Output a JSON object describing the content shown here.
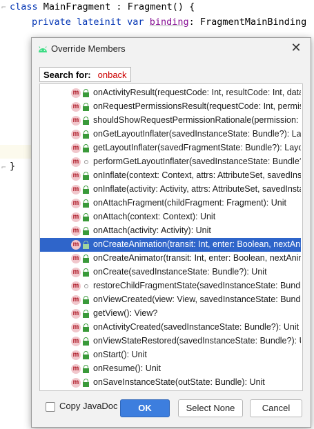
{
  "editor": {
    "line1": {
      "kw": "class",
      "text": " MainFragment : Fragment() {"
    },
    "line2": {
      "kw": "private lateinit var",
      "prop": "binding",
      "text": ": FragmentMainBinding"
    },
    "closing_brace": "}"
  },
  "dialog": {
    "title": "Override Members",
    "close_glyph": "✕",
    "search": {
      "label": "Search for:",
      "value": "onback"
    },
    "members": [
      {
        "sig": "onActivityResult(requestCode: Int, resultCode: Int, data: I",
        "vis": "lock",
        "selected": false
      },
      {
        "sig": "onRequestPermissionsResult(requestCode: Int, permissio",
        "vis": "lock",
        "selected": false
      },
      {
        "sig": "shouldShowRequestPermissionRationale(permission: Stri",
        "vis": "lock",
        "selected": false
      },
      {
        "sig": "onGetLayoutInflater(savedInstanceState: Bundle?): Layou",
        "vis": "lock",
        "selected": false
      },
      {
        "sig": "getLayoutInflater(savedFragmentState: Bundle?): LayoutI",
        "vis": "lock",
        "selected": false
      },
      {
        "sig": "performGetLayoutInflater(savedInstanceState: Bundle?): ",
        "vis": "circle",
        "selected": false
      },
      {
        "sig": "onInflate(context: Context, attrs: AttributeSet, savedInsta",
        "vis": "lock",
        "selected": false
      },
      {
        "sig": "onInflate(activity: Activity, attrs: AttributeSet, savedInsta",
        "vis": "lock",
        "selected": false
      },
      {
        "sig": "onAttachFragment(childFragment: Fragment): Unit",
        "vis": "lock",
        "selected": false
      },
      {
        "sig": "onAttach(context: Context): Unit",
        "vis": "lock",
        "selected": false
      },
      {
        "sig": "onAttach(activity: Activity): Unit",
        "vis": "lock",
        "selected": false
      },
      {
        "sig": "onCreateAnimation(transit: Int, enter: Boolean, nextAnim",
        "vis": "lock",
        "selected": true
      },
      {
        "sig": "onCreateAnimator(transit: Int, enter: Boolean, nextAnim:",
        "vis": "lock",
        "selected": false
      },
      {
        "sig": "onCreate(savedInstanceState: Bundle?): Unit",
        "vis": "lock",
        "selected": false
      },
      {
        "sig": "restoreChildFragmentState(savedInstanceState: Bundle?)",
        "vis": "circle",
        "selected": false
      },
      {
        "sig": "onViewCreated(view: View, savedInstanceState: Bundle?)",
        "vis": "lock",
        "selected": false
      },
      {
        "sig": "getView(): View?",
        "vis": "lock",
        "selected": false
      },
      {
        "sig": "onActivityCreated(savedInstanceState: Bundle?): Unit",
        "vis": "lock",
        "selected": false
      },
      {
        "sig": "onViewStateRestored(savedInstanceState: Bundle?): Unit",
        "vis": "lock",
        "selected": false
      },
      {
        "sig": "onStart(): Unit",
        "vis": "lock",
        "selected": false
      },
      {
        "sig": "onResume(): Unit",
        "vis": "lock",
        "selected": false
      },
      {
        "sig": "onSaveInstanceState(outState: Bundle): Unit",
        "vis": "lock",
        "selected": false
      }
    ],
    "member_badge": "m",
    "copy_javadoc_label": "Copy JavaDoc",
    "ok_label": "OK",
    "select_none_label": "Select None",
    "cancel_label": "Cancel"
  },
  "colors": {
    "selection": "#2f65ca",
    "ok_button": "#3d7ede",
    "search_value": "#cc0000",
    "android_icon": "#3ddc84"
  }
}
